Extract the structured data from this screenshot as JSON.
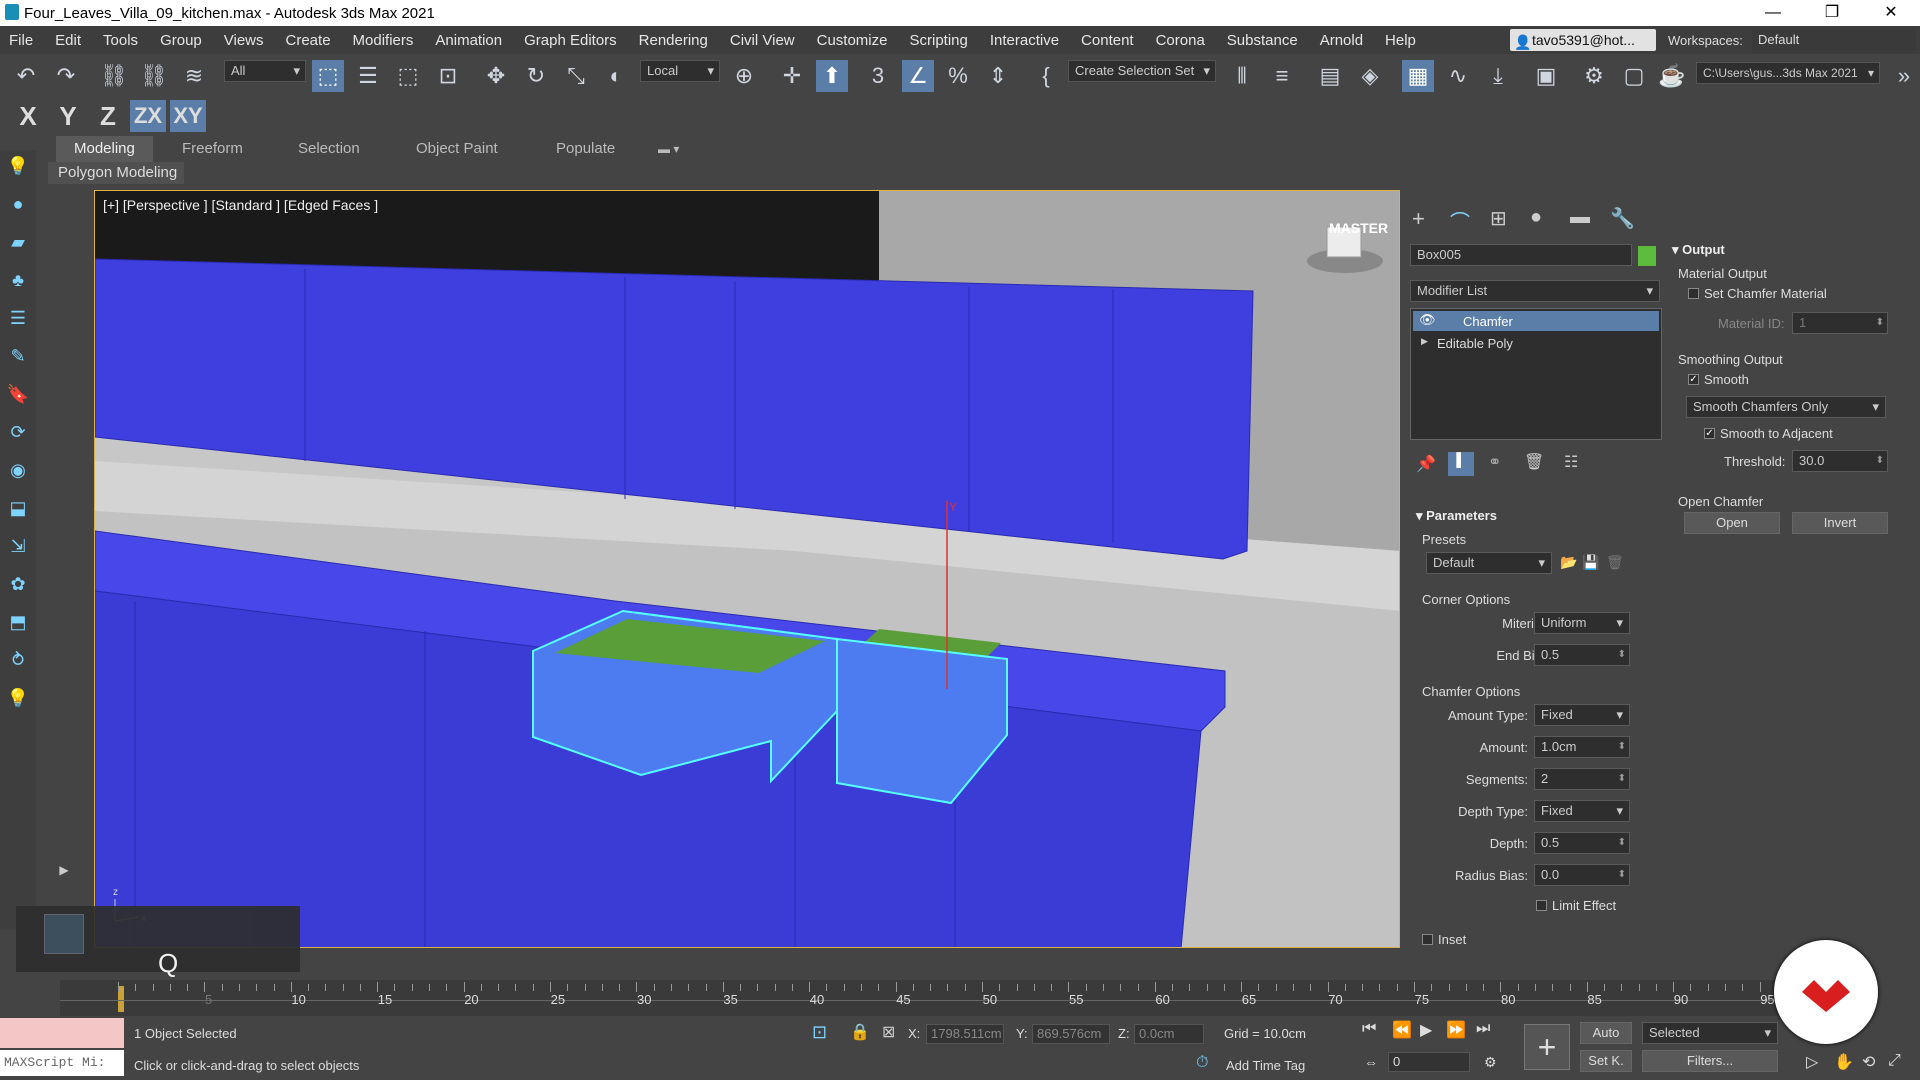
{
  "window": {
    "title": "Four_Leaves_Villa_09_kitchen.max - Autodesk 3ds Max 2021",
    "minimize": "—",
    "maximize": "❐",
    "close": "✕"
  },
  "menu": [
    "File",
    "Edit",
    "Tools",
    "Group",
    "Views",
    "Create",
    "Modifiers",
    "Animation",
    "Graph Editors",
    "Rendering",
    "Civil View",
    "Customize",
    "Scripting",
    "Interactive",
    "Content",
    "Corona",
    "Substance",
    "Arnold",
    "Help"
  ],
  "user": "tavo5391@hot...",
  "workspace": {
    "label": "Workspaces:",
    "value": "Default"
  },
  "toolbar": {
    "filter": "All",
    "ref_coord": "Local",
    "selection_set": "Create Selection Set",
    "project_path": "C:\\Users\\gus...3ds Max 2021"
  },
  "axes": [
    "X",
    "Y",
    "Z",
    "ZX",
    "XY"
  ],
  "ribbon": {
    "tabs": [
      "Modeling",
      "Freeform",
      "Selection",
      "Object Paint",
      "Populate"
    ],
    "sub": "Polygon Modeling"
  },
  "viewport": {
    "label": "[+] [Perspective ] [Standard ] [Edged Faces ]",
    "viewcube": "MASTER"
  },
  "command_panel": {
    "object_name": "Box005",
    "object_color": "#5dbb3d",
    "modifier_list": "Modifier List",
    "stack": [
      "Chamfer",
      "Editable Poly"
    ],
    "parameters": {
      "title": "Parameters",
      "presets_label": "Presets",
      "presets_value": "Default",
      "corner_options": "Corner Options",
      "mitering_label": "Mitering:",
      "mitering_value": "Uniform",
      "end_bias_label": "End Bias:",
      "end_bias_value": "0.5",
      "chamfer_options": "Chamfer Options",
      "amount_type_label": "Amount Type:",
      "amount_type_value": "Fixed",
      "amount_label": "Amount:",
      "amount_value": "1.0cm",
      "segments_label": "Segments:",
      "segments_value": "2",
      "depth_type_label": "Depth Type:",
      "depth_type_value": "Fixed",
      "depth_label": "Depth:",
      "depth_value": "0.5",
      "radius_bias_label": "Radius Bias:",
      "radius_bias_value": "0.0",
      "limit_effect": "Limit Effect",
      "inset": "Inset"
    },
    "output": {
      "title": "Output",
      "material_output": "Material Output",
      "set_chamfer_material": "Set Chamfer Material",
      "material_id_label": "Material ID:",
      "material_id_value": "1",
      "smoothing_output": "Smoothing Output",
      "smooth": "Smooth",
      "smooth_mode": "Smooth Chamfers Only",
      "smooth_to_adjacent": "Smooth to Adjacent",
      "threshold_label": "Threshold:",
      "threshold_value": "30.0",
      "open_chamfer": "Open Chamfer",
      "open": "Open",
      "invert": "Invert"
    }
  },
  "timeline": {
    "ticks": [
      "5",
      "10",
      "15",
      "20",
      "25",
      "30",
      "35",
      "40",
      "45",
      "50",
      "55",
      "60",
      "65",
      "70",
      "75",
      "80",
      "85",
      "90",
      "95"
    ],
    "slider": "0 / 100",
    "key_hint": "Q"
  },
  "status": {
    "maxscript": "MAXScript Mi:",
    "selected": "1 Object Selected",
    "prompt": "Click or click-and-drag to select objects",
    "x_label": "X:",
    "x_value": "1798.511cm",
    "y_label": "Y:",
    "y_value": "869.576cm",
    "z_label": "Z:",
    "z_value": "0.0cm",
    "grid": "Grid = 10.0cm",
    "add_time_tag": "Add Time Tag",
    "auto": "Auto",
    "set_key": "Set K.",
    "selected_dd": "Selected",
    "filters": "Filters...",
    "frame": "0"
  }
}
